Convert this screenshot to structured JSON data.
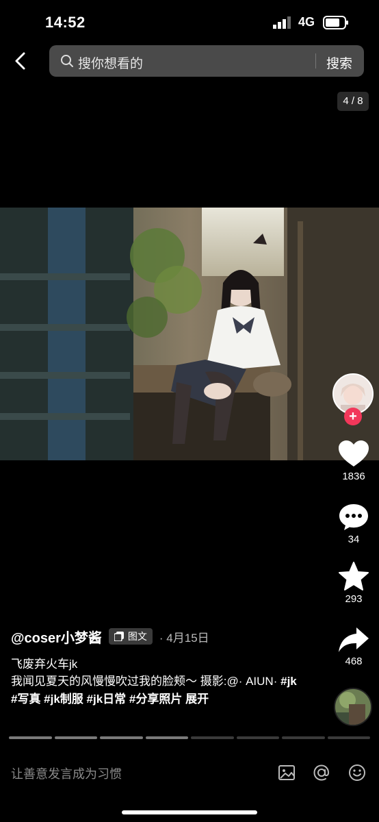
{
  "status_bar": {
    "time": "14:52",
    "network": "4G",
    "icons": [
      "signal-icon",
      "battery-icon"
    ]
  },
  "search": {
    "placeholder": "搜你想看的",
    "button_label": "搜索"
  },
  "page_counter": "4 / 8",
  "actions": {
    "like_count": "1836",
    "comment_count": "34",
    "favorite_count": "293",
    "share_count": "468",
    "follow_symbol": "+"
  },
  "post": {
    "author": "@coser小梦酱",
    "type_badge": "图文",
    "separator": "·",
    "date": "4月15日",
    "title": "飞废弃火车jk",
    "description": "我闻见夏天的风慢慢吹过我的脸颊～ 摄影:@· AIUN·",
    "tags": "#jk #写真 #jk制服 #jk日常 #分享照片",
    "expand_label": "展开"
  },
  "progress": {
    "total": 8,
    "current": 4
  },
  "comment_bar": {
    "placeholder": "让善意发言成为习惯",
    "icons": [
      "image-icon",
      "at-icon",
      "emoji-icon"
    ]
  },
  "colors": {
    "background": "#000000",
    "accent": "#f2375a",
    "search_bg": "#4a4a4a"
  }
}
